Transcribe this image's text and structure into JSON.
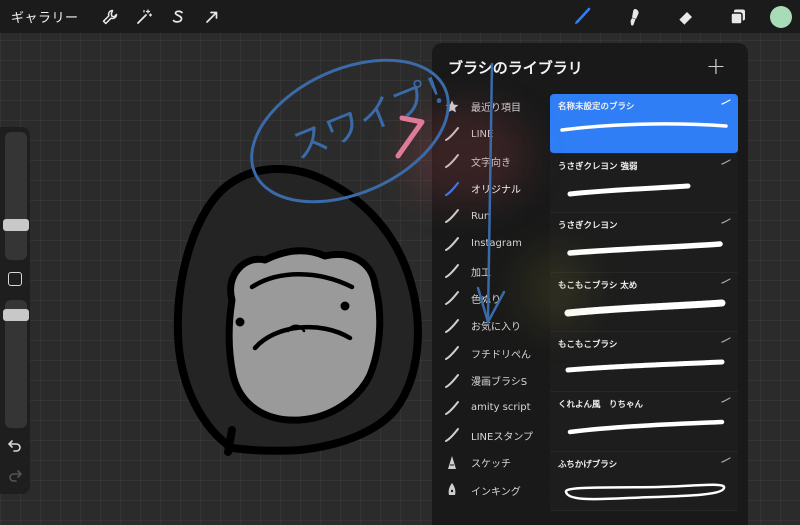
{
  "topbar": {
    "gallery_label": "ギャラリー",
    "tools_left": [
      "wrench-icon",
      "magic-wand-icon",
      "selection-s-icon",
      "arrow-transform-icon"
    ],
    "tools_right": [
      "brush-icon",
      "smudge-icon",
      "eraser-icon",
      "layers-icon"
    ],
    "current_color": "#a8dcb8",
    "active_tool_color": "#2f7ef6"
  },
  "library": {
    "title": "ブラシのライブラリ",
    "add_label": "+",
    "sets": [
      {
        "label": "最近り項目",
        "icon": "star-icon"
      },
      {
        "label": "LINE",
        "icon": "stroke-icon"
      },
      {
        "label": "文字向き",
        "icon": "stroke-icon"
      },
      {
        "label": "オリジナル",
        "icon": "stroke-icon"
      },
      {
        "label": "Run",
        "icon": "stroke-icon"
      },
      {
        "label": "Instagram",
        "icon": "stroke-icon"
      },
      {
        "label": "加工",
        "icon": "stroke-icon"
      },
      {
        "label": "色ぬり",
        "icon": "stroke-icon"
      },
      {
        "label": "お気に入り",
        "icon": "stroke-icon"
      },
      {
        "label": "フチドリぺん",
        "icon": "stroke-icon"
      },
      {
        "label": "漫画ブラシS",
        "icon": "stroke-icon"
      },
      {
        "label": "amity script",
        "icon": "stroke-icon"
      },
      {
        "label": "LINEスタンプ",
        "icon": "stroke-icon"
      },
      {
        "label": "スケッチ",
        "icon": "pencil-tip-icon"
      },
      {
        "label": "インキング",
        "icon": "ink-nib-icon"
      }
    ],
    "brushes": [
      {
        "name": "名称未設定のブラシ"
      },
      {
        "name": "うさぎクレヨン 強弱"
      },
      {
        "name": "うさぎクレヨン"
      },
      {
        "name": "もこもこブラシ 太め"
      },
      {
        "name": "もこもこブラシ"
      },
      {
        "name": "くれよん風　りちゃん"
      },
      {
        "name": "ふちかげブラシ"
      }
    ]
  },
  "annotation": {
    "text": "スワイプ！",
    "color": "#3a6aa8",
    "highlight_color": "#e07a9a"
  }
}
